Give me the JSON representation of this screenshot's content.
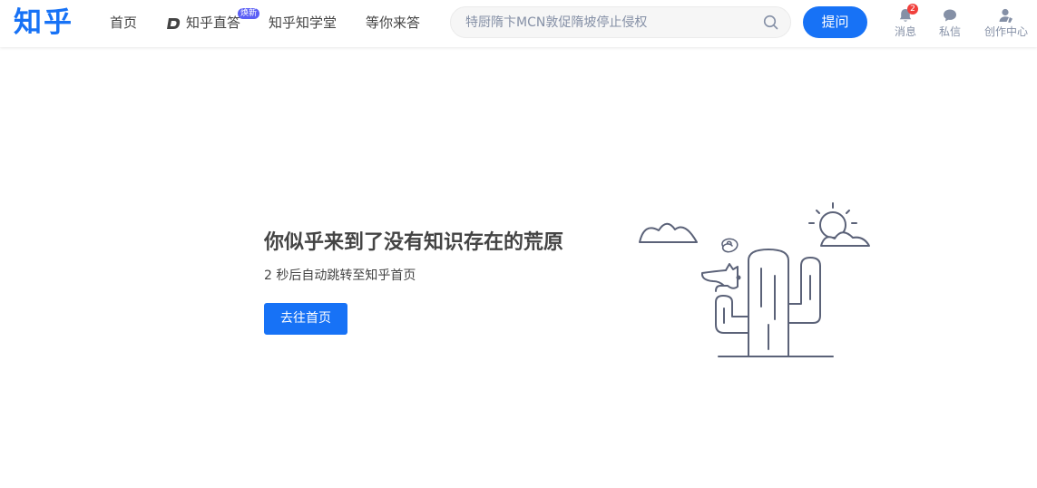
{
  "header": {
    "logo": "知乎",
    "nav": {
      "home": "首页",
      "zhida": "知乎直答",
      "zhida_badge": "焕新",
      "xuetang": "知乎知学堂",
      "waiting": "等你来答"
    },
    "search_placeholder": "特厨隋卞MCN敦促隋坡停止侵权",
    "ask_label": "提问",
    "tools": {
      "messages": "消息",
      "messages_count": "2",
      "chat": "私信",
      "creator": "创作中心"
    }
  },
  "main": {
    "title": "你似乎来到了没有知识存在的荒原",
    "countdown": "2 秒后自动跳转至知乎首页",
    "home_button": "去往首页"
  },
  "colors": {
    "brand": "#1772f6",
    "text": "#444444",
    "muted": "#8590a6",
    "badge_red": "#f1403c"
  },
  "icons": [
    "zhida-icon",
    "search-icon",
    "bell-icon",
    "chat-bubble-icon",
    "creator-icon",
    "cactus-illustration"
  ]
}
